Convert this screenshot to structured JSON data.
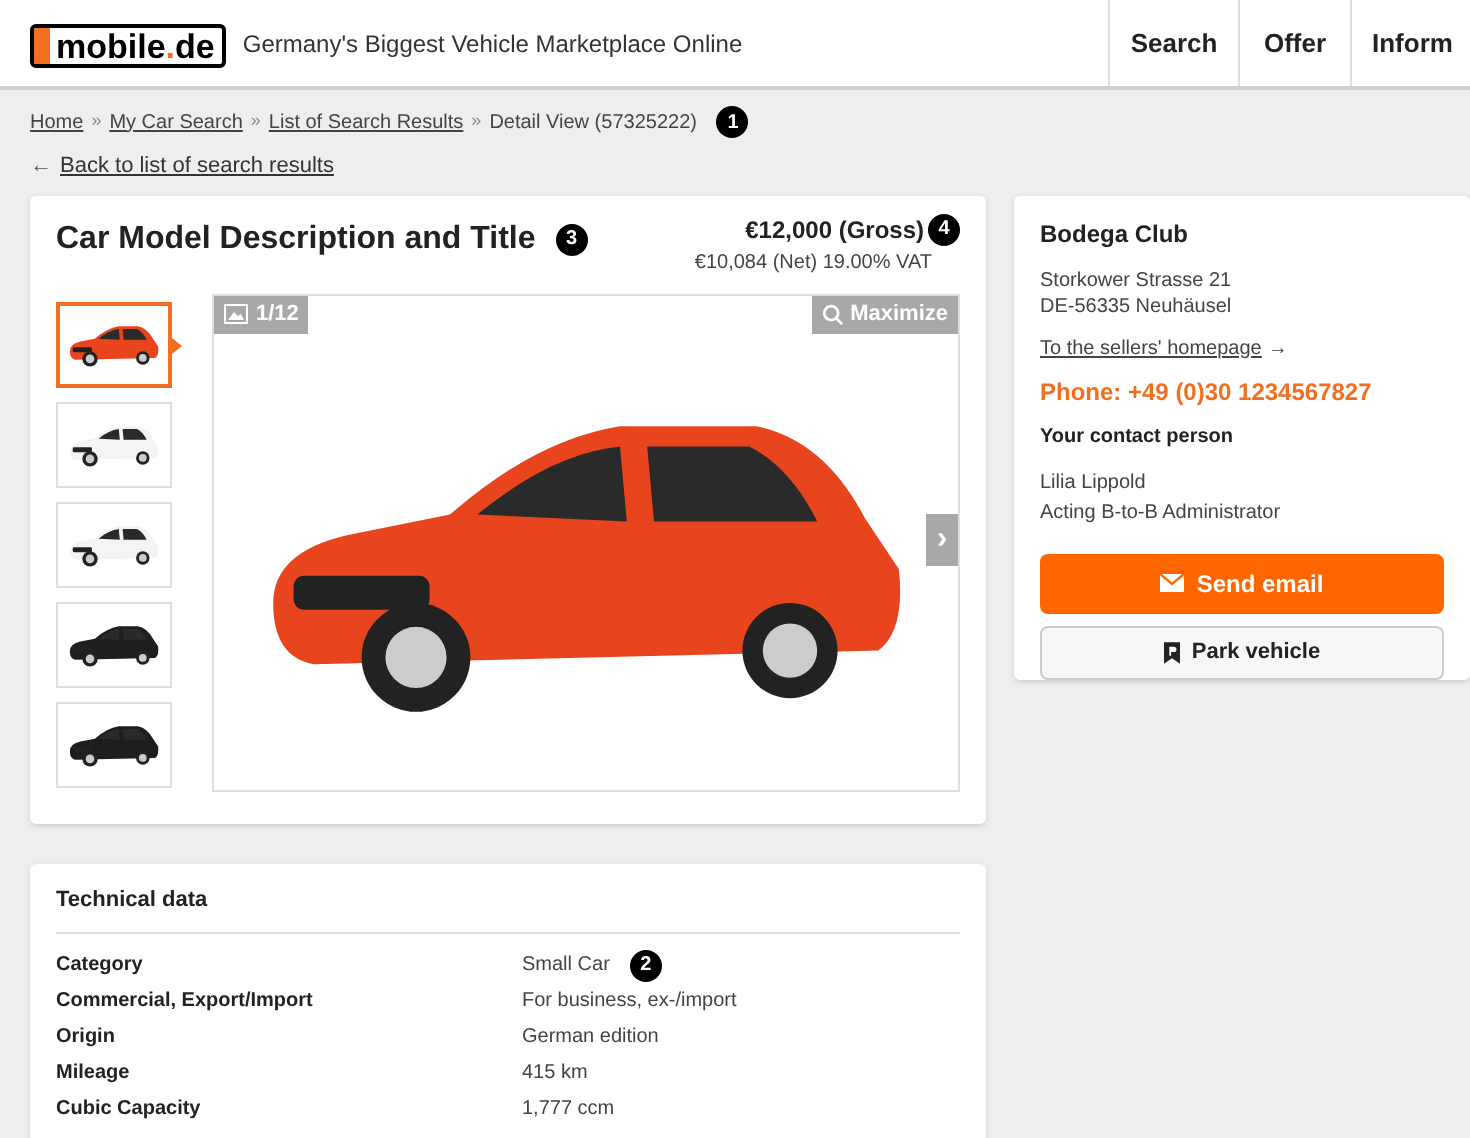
{
  "header": {
    "logo": {
      "text": "mobile",
      "accent": ".de"
    },
    "tagline": "Germany's Biggest Vehicle Marketplace Online",
    "nav": [
      {
        "label": "Search"
      },
      {
        "label": "Offer"
      },
      {
        "label": "Inform"
      }
    ]
  },
  "breadcrumb": {
    "items": [
      {
        "label": "Home",
        "link": true
      },
      {
        "label": "My Car Search",
        "link": true
      },
      {
        "label": "List of Search Results",
        "link": true
      },
      {
        "label": "Detail View (57325222)",
        "link": false
      }
    ],
    "separator": "»",
    "marker": "1"
  },
  "back_link": {
    "arrow": "←",
    "label": "Back to list of search results"
  },
  "listing": {
    "title": "Car Model Description and Title",
    "title_marker": "3",
    "price_gross": "€12,000 (Gross)",
    "price_marker": "4",
    "price_net": "€10,084 (Net) 19.00% VAT",
    "gallery": {
      "counter": "1/12",
      "maximize": "Maximize",
      "next": "›",
      "thumbnails": [
        {
          "selected": true
        },
        {
          "selected": false
        },
        {
          "selected": false
        },
        {
          "selected": false
        },
        {
          "selected": false
        }
      ]
    }
  },
  "seller": {
    "name": "Bodega Club",
    "address": [
      "Storkower Strasse 21",
      "DE-56335 Neuhäusel"
    ],
    "homepage_link": "To the sellers' homepage",
    "homepage_arrow": "→",
    "phone": "Phone: +49 (0)30 1234567827",
    "contact_heading": "Your contact person",
    "contact_name": "Lilia Lippold",
    "contact_role": "Acting B-to-B Administrator",
    "buttons": [
      {
        "kind": "primary",
        "label": "Send email"
      },
      {
        "kind": "secondary",
        "label": "Park vehicle"
      }
    ]
  },
  "technical_data": {
    "heading": "Technical data",
    "rows": [
      {
        "label": "Category",
        "value": "Small Car",
        "marker": "2"
      },
      {
        "label": "Commercial, Export/Import",
        "value": "For business, ex-/import"
      },
      {
        "label": "Origin",
        "value": "German edition"
      },
      {
        "label": "Mileage",
        "value": "415 km"
      },
      {
        "label": "Cubic Capacity",
        "value": "1,777 ccm"
      }
    ]
  }
}
